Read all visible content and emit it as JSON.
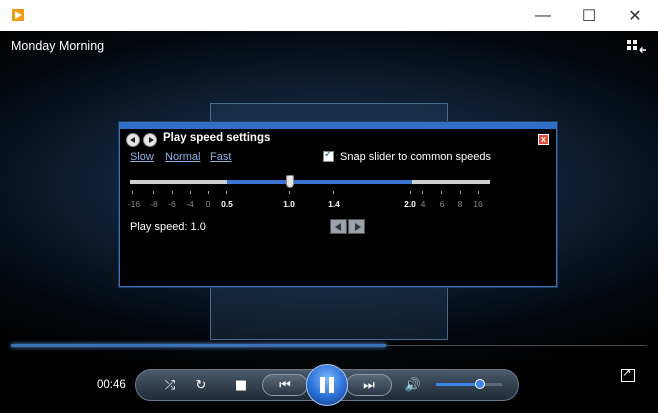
{
  "window": {
    "minimize_glyph": "—",
    "maximize_glyph": "☐",
    "close_glyph": "✕"
  },
  "video": {
    "title": "Monday Morning"
  },
  "speed_panel": {
    "title": "Play speed settings",
    "close_glyph": "x",
    "links": {
      "slow": "Slow",
      "normal": "Normal",
      "fast": "Fast"
    },
    "snap_label": "Snap slider to common speeds",
    "snap_checked": true,
    "ticks": [
      "-16",
      "-8",
      "-6",
      "-4",
      "0",
      "0.5",
      "1.0",
      "1.4",
      "2.0",
      "4",
      "6",
      "8",
      "16"
    ],
    "play_speed_text": "Play speed: 1.0",
    "current_speed": 1.0
  },
  "player": {
    "time": "00:46",
    "seek_progress_fraction": 0.59,
    "volume_fraction": 0.67,
    "shuffle_glyph": "⤮",
    "repeat_glyph": "↻",
    "stop_glyph": "■",
    "prev_glyph": "⏮",
    "next_glyph": "⏭",
    "volume_glyph": "🔊"
  }
}
